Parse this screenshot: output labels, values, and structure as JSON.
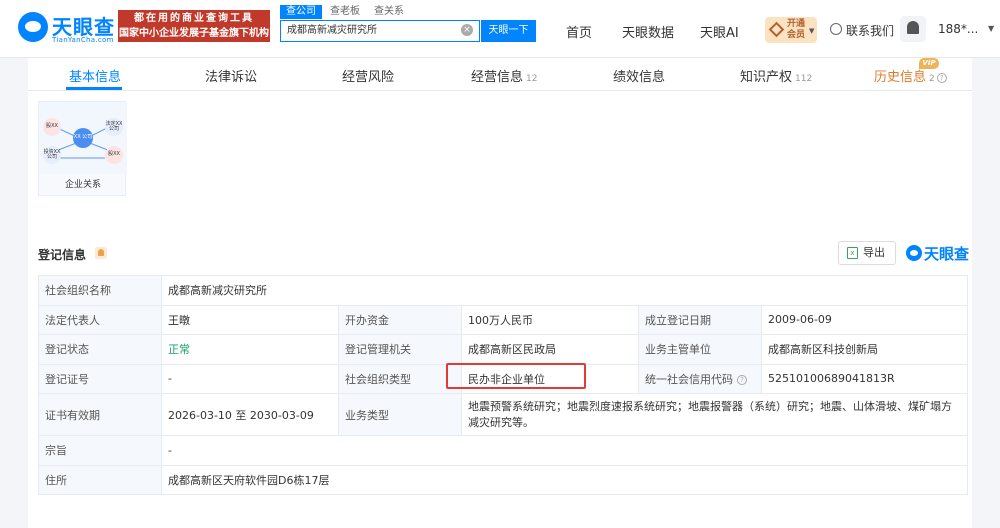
{
  "header": {
    "logo_text": "天眼查",
    "logo_sub": "TianYanCha.com",
    "slogan_line1": "都在用的商业查询工具",
    "slogan_line2": "国家中小企业发展子基金旗下机构",
    "search_tabs": [
      "查公司",
      "查老板",
      "查关系"
    ],
    "search_value": "成都高新减灾研究所",
    "search_button": "天眼一下",
    "nav": [
      "首页",
      "天眼数据",
      "天眼AI"
    ],
    "vip_line1": "开通",
    "vip_line2": "会员",
    "contact": "联系我们",
    "user": "188*..."
  },
  "tabs": [
    {
      "label": "基本信息",
      "count": ""
    },
    {
      "label": "法律诉讼",
      "count": ""
    },
    {
      "label": "经营风险",
      "count": ""
    },
    {
      "label": "经营信息",
      "count": "12"
    },
    {
      "label": "绩效信息",
      "count": ""
    },
    {
      "label": "知识产权",
      "count": "112"
    },
    {
      "label": "历史信息",
      "count": "2"
    }
  ],
  "vip_badge": "VIP",
  "relation_card": {
    "label": "企业关系",
    "nodes": [
      "股XX",
      "XX\n公司",
      "法定XX\n公司",
      "投资XX\n公司",
      "股XX"
    ]
  },
  "section": {
    "title": "登记信息",
    "export": "导出",
    "brand": "天眼查"
  },
  "info": {
    "row1": {
      "l1": "社会组织名称",
      "v1": "成都高新减灾研究所"
    },
    "row2": {
      "l1": "法定代表人",
      "v1": "王暾",
      "l2": "开办资金",
      "v2": "100万人民币",
      "l3": "成立登记日期",
      "v3": "2009-06-09"
    },
    "row3": {
      "l1": "登记状态",
      "v1": "正常",
      "l2": "登记管理机关",
      "v2": "成都高新区民政局",
      "l3": "业务主管单位",
      "v3": "成都高新区科技创新局"
    },
    "row4": {
      "l1": "登记证号",
      "v1": "-",
      "l2": "社会组织类型",
      "v2": "民办非企业单位",
      "l3": "统一社会信用代码",
      "v3": "52510100689041813R"
    },
    "row5": {
      "l1": "证书有效期",
      "v1": "2026-03-10 至 2030-03-09",
      "l2": "业务类型",
      "v2": "地震预警系统研究；地震烈度速报系统研究；地震报警器（系统）研究；地震、山体滑坡、煤矿塌方减灾研究等。"
    },
    "row6": {
      "l1": "宗旨",
      "v1": "-"
    },
    "row7": {
      "l1": "住所",
      "v1": "成都高新区天府软件园D6栋17层"
    }
  },
  "colors": {
    "accent": "#0084ff",
    "status_ok": "#18a06a",
    "highlight": "#e53935",
    "history": "#e07a2d"
  }
}
